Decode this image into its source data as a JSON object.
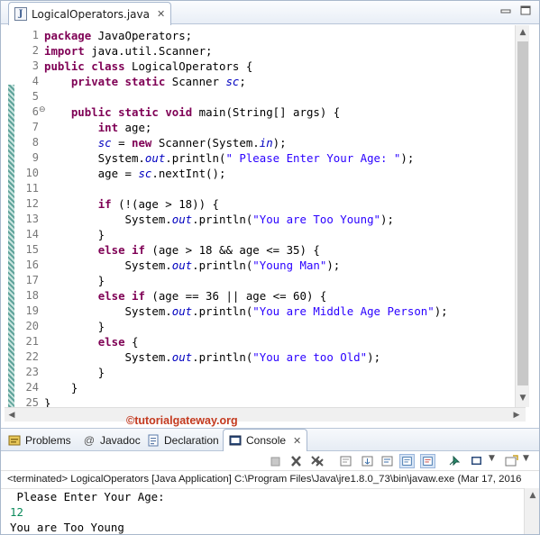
{
  "editor": {
    "tab_title": "LogicalOperators.java",
    "tab_icon": "java-file-icon",
    "line_numbers": [
      "1",
      "2",
      "3",
      "4",
      "5",
      "6",
      "7",
      "8",
      "9",
      "10",
      "11",
      "12",
      "13",
      "14",
      "15",
      "16",
      "17",
      "18",
      "19",
      "20",
      "21",
      "22",
      "23",
      "24",
      "25"
    ],
    "fold_marker": "⊖",
    "lines": [
      [
        [
          "kw",
          "package"
        ],
        [
          "t",
          " JavaOperators;"
        ]
      ],
      [
        [
          "kw",
          "import"
        ],
        [
          "t",
          " java.util.Scanner;"
        ]
      ],
      [
        [
          "kw",
          "public"
        ],
        [
          "t",
          " "
        ],
        [
          "kw",
          "class"
        ],
        [
          "t",
          " LogicalOperators {"
        ]
      ],
      [
        [
          "t",
          "    "
        ],
        [
          "kw",
          "private"
        ],
        [
          "t",
          " "
        ],
        [
          "kw",
          "static"
        ],
        [
          "t",
          " Scanner "
        ],
        [
          "fld",
          "sc"
        ],
        [
          "t",
          ";"
        ]
      ],
      [
        [
          "t",
          ""
        ]
      ],
      [
        [
          "t",
          "    "
        ],
        [
          "kw",
          "public"
        ],
        [
          "t",
          " "
        ],
        [
          "kw",
          "static"
        ],
        [
          "t",
          " "
        ],
        [
          "kw",
          "void"
        ],
        [
          "t",
          " main(String[] args) {"
        ]
      ],
      [
        [
          "t",
          "        "
        ],
        [
          "kw",
          "int"
        ],
        [
          "t",
          " age;"
        ]
      ],
      [
        [
          "t",
          "        "
        ],
        [
          "fld",
          "sc"
        ],
        [
          "t",
          " = "
        ],
        [
          "kw",
          "new"
        ],
        [
          "t",
          " Scanner(System."
        ],
        [
          "fld",
          "in"
        ],
        [
          "t",
          ");"
        ]
      ],
      [
        [
          "t",
          "        System."
        ],
        [
          "fld",
          "out"
        ],
        [
          "t",
          ".println("
        ],
        [
          "str",
          "\" Please Enter Your Age: \""
        ],
        [
          "t",
          ");"
        ]
      ],
      [
        [
          "t",
          "        age = "
        ],
        [
          "fld",
          "sc"
        ],
        [
          "t",
          ".nextInt();"
        ]
      ],
      [
        [
          "t",
          ""
        ]
      ],
      [
        [
          "t",
          "        "
        ],
        [
          "kw",
          "if"
        ],
        [
          "t",
          " (!(age > 18)) {"
        ]
      ],
      [
        [
          "t",
          "            System."
        ],
        [
          "fld",
          "out"
        ],
        [
          "t",
          ".println("
        ],
        [
          "str",
          "\"You are Too Young\""
        ],
        [
          "t",
          ");"
        ]
      ],
      [
        [
          "t",
          "        }"
        ]
      ],
      [
        [
          "t",
          "        "
        ],
        [
          "kw",
          "else"
        ],
        [
          "t",
          " "
        ],
        [
          "kw",
          "if"
        ],
        [
          "t",
          " (age > 18 && age <= 35) {"
        ]
      ],
      [
        [
          "t",
          "            System."
        ],
        [
          "fld",
          "out"
        ],
        [
          "t",
          ".println("
        ],
        [
          "str",
          "\"Young Man\""
        ],
        [
          "t",
          ");"
        ]
      ],
      [
        [
          "t",
          "        }"
        ]
      ],
      [
        [
          "t",
          "        "
        ],
        [
          "kw",
          "else"
        ],
        [
          "t",
          " "
        ],
        [
          "kw",
          "if"
        ],
        [
          "t",
          " (age == 36 || age <= 60) {"
        ]
      ],
      [
        [
          "t",
          "            System."
        ],
        [
          "fld",
          "out"
        ],
        [
          "t",
          ".println("
        ],
        [
          "str",
          "\"You are Middle Age Person\""
        ],
        [
          "t",
          ");"
        ]
      ],
      [
        [
          "t",
          "        }"
        ]
      ],
      [
        [
          "t",
          "        "
        ],
        [
          "kw",
          "else"
        ],
        [
          "t",
          " {"
        ]
      ],
      [
        [
          "t",
          "            System."
        ],
        [
          "fld",
          "out"
        ],
        [
          "t",
          ".println("
        ],
        [
          "str",
          "\"You are too Old\""
        ],
        [
          "t",
          ");"
        ]
      ],
      [
        [
          "t",
          "        }"
        ]
      ],
      [
        [
          "t",
          "    }"
        ]
      ],
      [
        [
          "t",
          "}"
        ]
      ]
    ]
  },
  "watermark": "©tutorialgateway.org",
  "views": {
    "problems": "Problems",
    "javadoc": "Javadoc",
    "declaration": "Declaration",
    "console": "Console"
  },
  "console": {
    "terminated_line": "<terminated> LogicalOperators [Java Application] C:\\Program Files\\Java\\jre1.8.0_73\\bin\\javaw.exe (Mar 17, 2016",
    "output_prompt": " Please Enter Your Age:",
    "user_input": "12",
    "output_result": "You are Too Young"
  },
  "colors": {
    "keyword": "#7f0055",
    "string": "#2a00ff",
    "field": "#0000c0",
    "console_input": "#0a8a5a",
    "watermark": "#c43a1f"
  }
}
